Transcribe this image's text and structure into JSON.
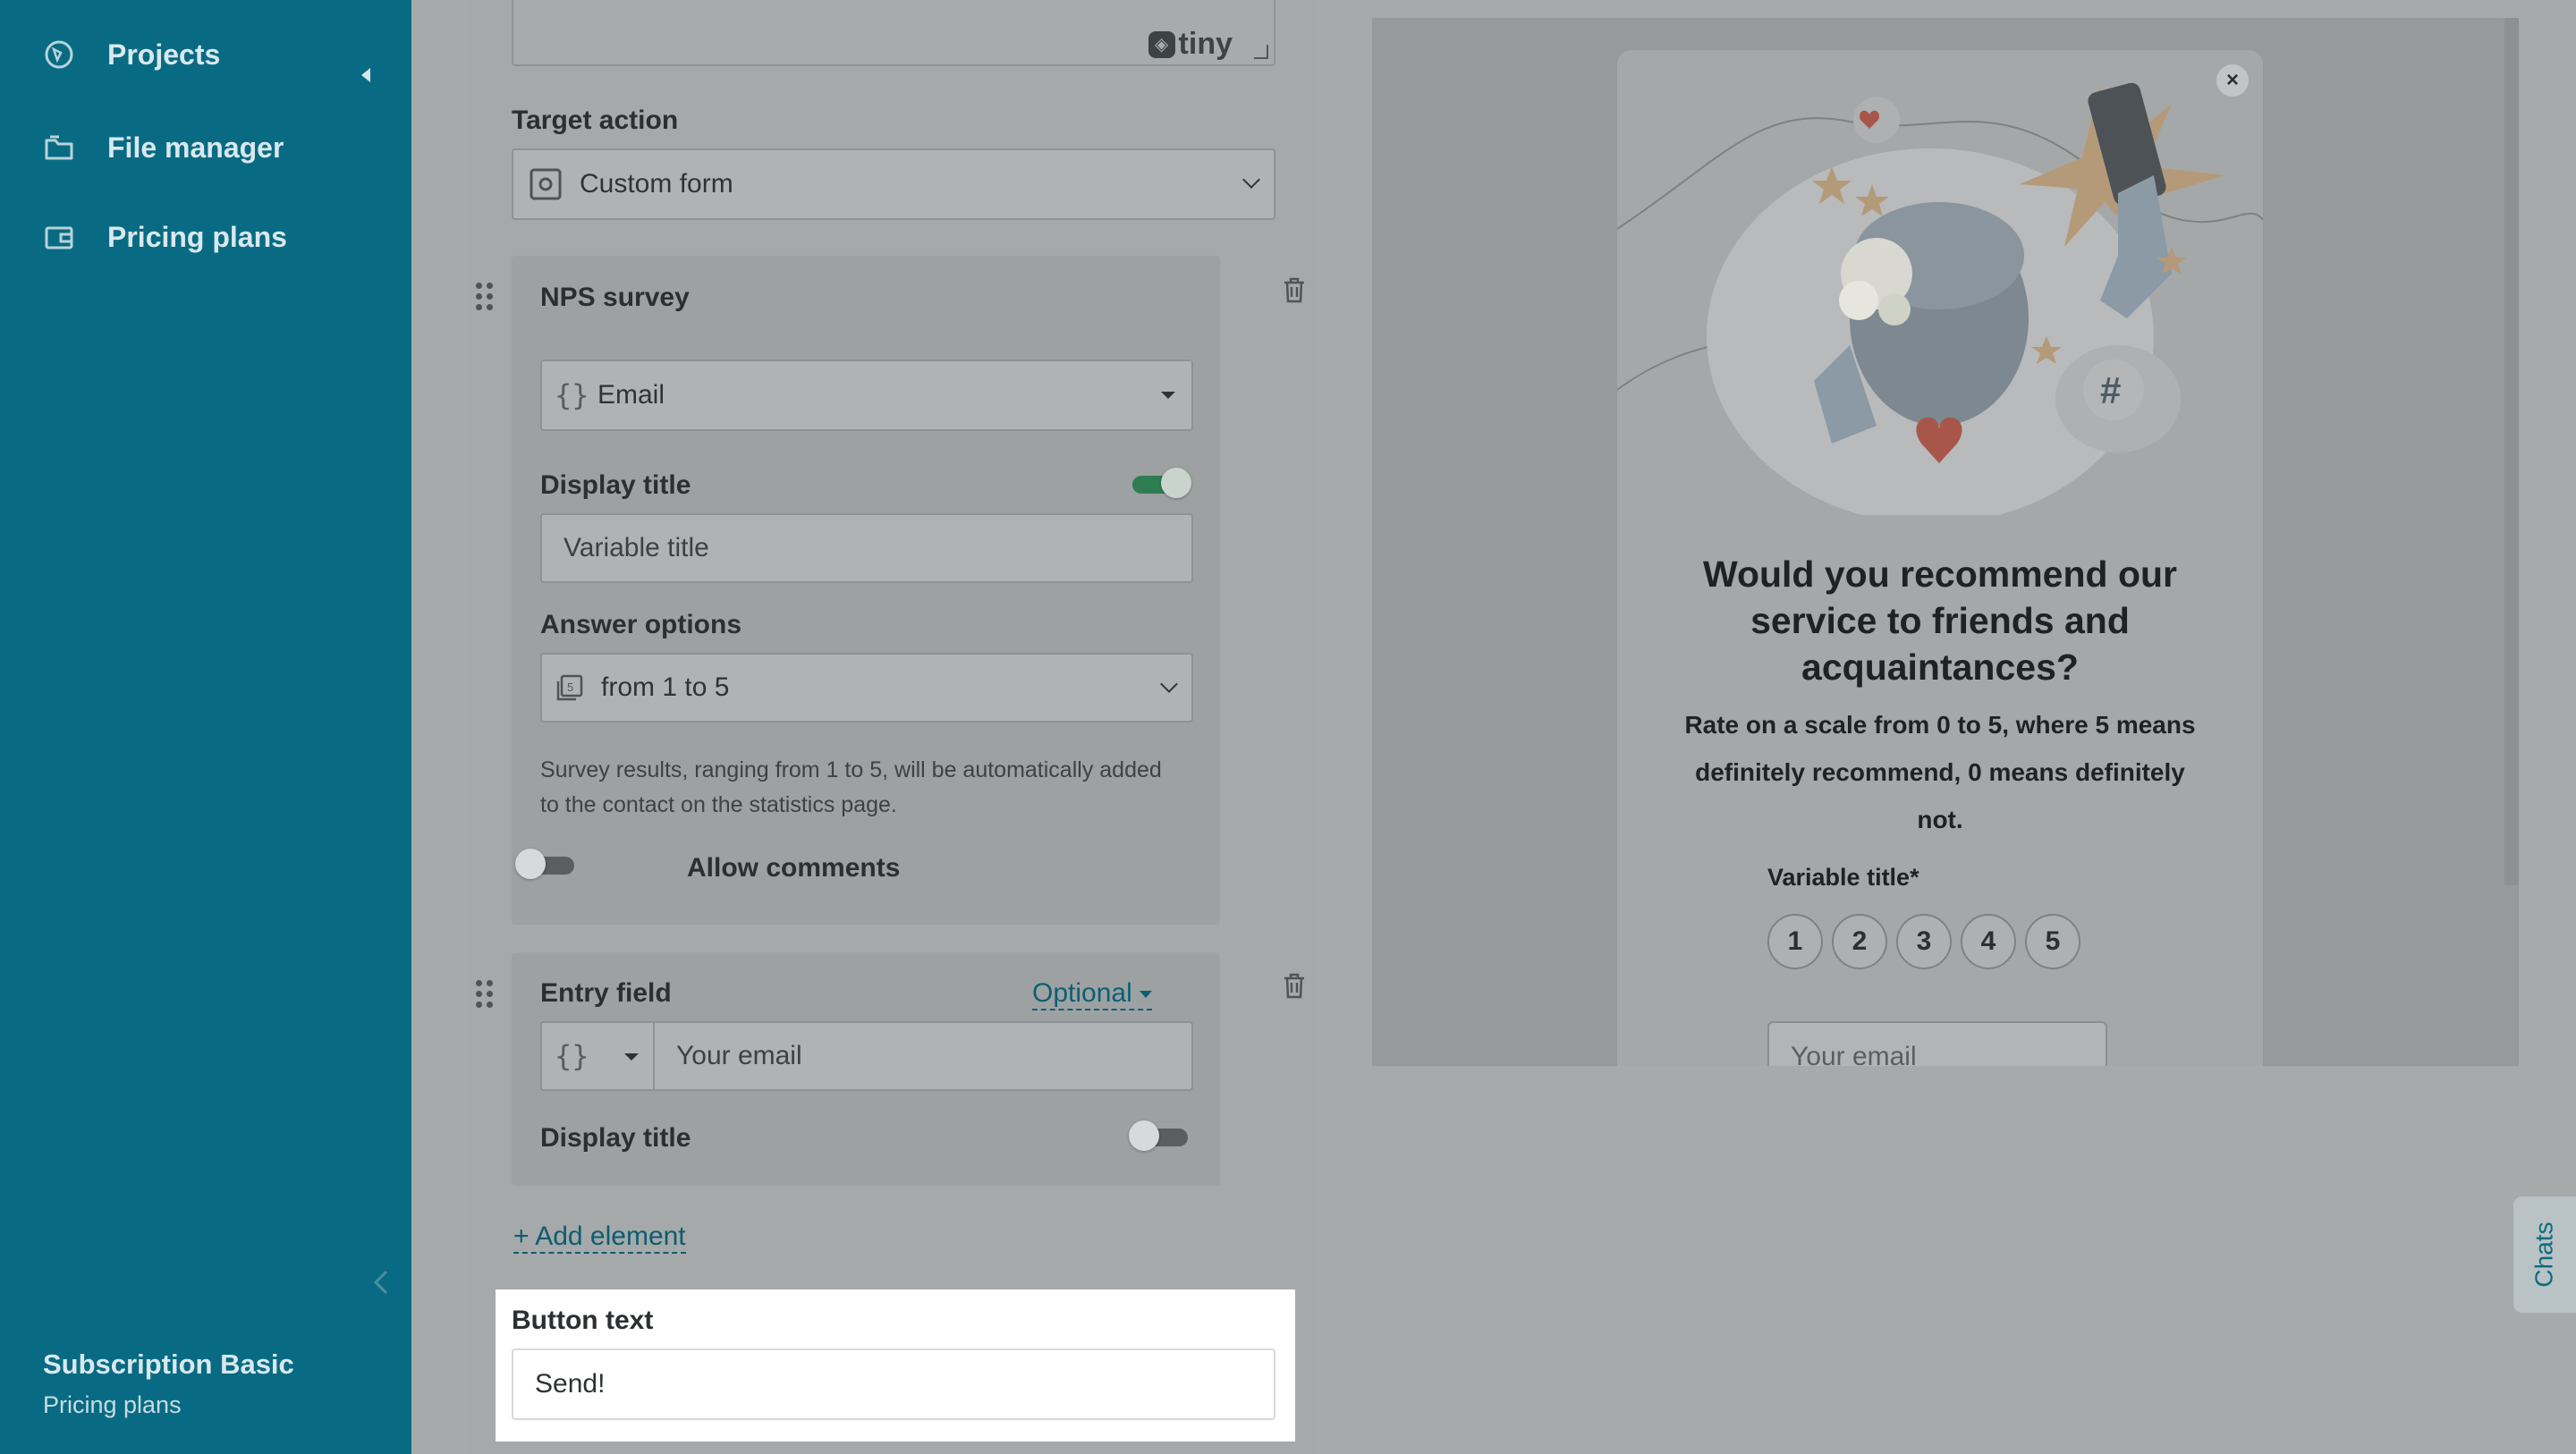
{
  "sidebar": {
    "items": [
      {
        "label": "Projects",
        "icon": "projects-icon"
      },
      {
        "label": "File manager",
        "icon": "folder-icon"
      },
      {
        "label": "Pricing plans",
        "icon": "wallet-icon"
      }
    ],
    "plan_name": "Subscription Basic",
    "plan_sub": "Pricing plans"
  },
  "editor": {
    "tiny_brand": "tiny",
    "target_action_label": "Target action",
    "target_action_value": "Custom form",
    "nps": {
      "title": "NPS survey",
      "variable_value": "Email",
      "display_title_label": "Display title",
      "display_title_on": true,
      "title_placeholder": "Variable title",
      "answer_options_label": "Answer options",
      "answer_options_value": "from 1 to 5",
      "hint": "Survey results, ranging from 1 to 5, will be automatically added to the contact on the statistics page.",
      "allow_comments_label": "Allow comments",
      "allow_comments_on": false
    },
    "entry": {
      "title": "Entry field",
      "optional_label": "Optional",
      "placeholder": "Your email",
      "display_title_label": "Display title",
      "display_title_on": false
    },
    "add_element_label": "+ Add element",
    "button_text_label": "Button text",
    "button_text_value": "Send!"
  },
  "preview": {
    "close_label": "×",
    "title": "Would you recommend our service to friends and acquaintances?",
    "description": "Rate on a scale from 0 to 5, where 5 means definitely recommend, 0 means definitely not.",
    "field_label": "Variable title*",
    "rating_values": [
      "1",
      "2",
      "3",
      "4",
      "5"
    ],
    "email_placeholder": "Your email"
  },
  "chats_label": "Chats",
  "colors": {
    "sidebar": "#086b83",
    "toggle_on": "#2f7c52",
    "link": "#0b5f74"
  }
}
